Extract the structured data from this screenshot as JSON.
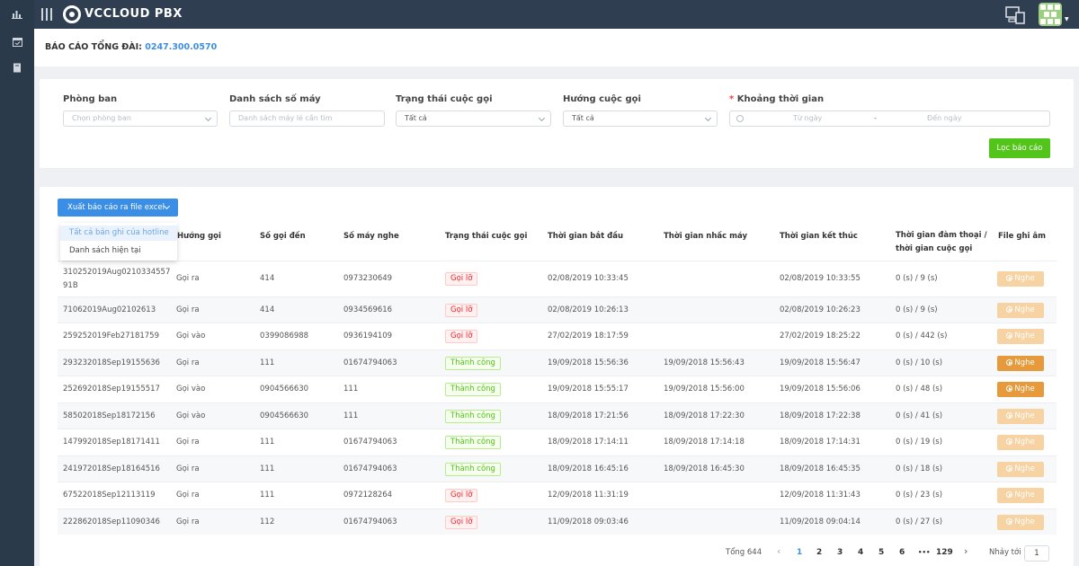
{
  "app": {
    "brand": "VCCLOUD PBX"
  },
  "report": {
    "title_prefix": "BÁO CÁO TỔNG ĐÀI:",
    "hotline": "0247.300.0570"
  },
  "filters": {
    "department": {
      "label": "Phòng ban",
      "placeholder": "Chọn phòng ban"
    },
    "extensions": {
      "label": "Danh sách số máy",
      "placeholder": "Danh sách máy lẻ cần tìm"
    },
    "call_status": {
      "label": "Trạng thái cuộc gọi",
      "value": "Tất cả"
    },
    "direction": {
      "label": "Hướng cuộc gọi",
      "value": "Tất cả"
    },
    "time_range": {
      "label": "Khoảng thời gian",
      "required_mark": "*",
      "from_placeholder": "Từ ngày",
      "separator": "-",
      "to_placeholder": "Đến ngày"
    },
    "submit_label": "Lọc báo cáo"
  },
  "export": {
    "button_label": "Xuất báo cáo ra file excel",
    "options": [
      "Tất cả bản ghi của hotline",
      "Danh sách hiện tại"
    ]
  },
  "table": {
    "columns": [
      "Hướng gọi",
      "Số gọi đến",
      "Số máy nghe",
      "Trạng thái cuộc gọi",
      "Thời gian bắt đầu",
      "Thời gian nhấc máy",
      "Thời gian kết thúc",
      "Thời gian đàm thoại /",
      "thời gian cuộc gọi",
      "File ghi âm"
    ],
    "play_label": "Nghe",
    "rows": [
      {
        "id1": "310252019Aug0210334557",
        "id2": "91B",
        "direction": "Gọi ra",
        "caller": "414",
        "callee": "0973230649",
        "status": "Gọi lỡ",
        "status_type": "fail",
        "start": "02/08/2019 10:33:45",
        "answer": "",
        "end": "02/08/2019 10:33:55",
        "duration": "0 (s) / 9 (s)",
        "playable": false
      },
      {
        "id1": "71062019Aug02102613",
        "id2": "",
        "direction": "Gọi ra",
        "caller": "414",
        "callee": "0934569616",
        "status": "Gọi lỡ",
        "status_type": "fail",
        "start": "02/08/2019 10:26:13",
        "answer": "",
        "end": "02/08/2019 10:26:23",
        "duration": "0 (s) / 9 (s)",
        "playable": false
      },
      {
        "id1": "259252019Feb27181759",
        "id2": "",
        "direction": "Gọi vào",
        "caller": "0399086988",
        "callee": "0936194109",
        "status": "Gọi lỡ",
        "status_type": "fail",
        "start": "27/02/2019 18:17:59",
        "answer": "",
        "end": "27/02/2019 18:25:22",
        "duration": "0 (s) / 442 (s)",
        "playable": false
      },
      {
        "id1": "293232018Sep19155636",
        "id2": "",
        "direction": "Gọi ra",
        "caller": "111",
        "callee": "01674794063",
        "status": "Thành công",
        "status_type": "ok",
        "start": "19/09/2018 15:56:36",
        "answer": "19/09/2018 15:56:43",
        "end": "19/09/2018 15:56:47",
        "duration": "0 (s) / 10 (s)",
        "playable": true
      },
      {
        "id1": "252692018Sep19155517",
        "id2": "",
        "direction": "Gọi vào",
        "caller": "0904566630",
        "callee": "111",
        "status": "Thành công",
        "status_type": "ok",
        "start": "19/09/2018 15:55:17",
        "answer": "19/09/2018 15:56:00",
        "end": "19/09/2018 15:56:06",
        "duration": "0 (s) / 48 (s)",
        "playable": true
      },
      {
        "id1": "58502018Sep18172156",
        "id2": "",
        "direction": "Gọi vào",
        "caller": "0904566630",
        "callee": "111",
        "status": "Thành công",
        "status_type": "ok",
        "start": "18/09/2018 17:21:56",
        "answer": "18/09/2018 17:22:30",
        "end": "18/09/2018 17:22:38",
        "duration": "0 (s) / 41 (s)",
        "playable": false
      },
      {
        "id1": "147992018Sep18171411",
        "id2": "",
        "direction": "Gọi ra",
        "caller": "111",
        "callee": "01674794063",
        "status": "Thành công",
        "status_type": "ok",
        "start": "18/09/2018 17:14:11",
        "answer": "18/09/2018 17:14:18",
        "end": "18/09/2018 17:14:31",
        "duration": "0 (s) / 19 (s)",
        "playable": false
      },
      {
        "id1": "241972018Sep18164516",
        "id2": "",
        "direction": "Gọi ra",
        "caller": "111",
        "callee": "01674794063",
        "status": "Thành công",
        "status_type": "ok",
        "start": "18/09/2018 16:45:16",
        "answer": "18/09/2018 16:45:30",
        "end": "18/09/2018 16:45:35",
        "duration": "0 (s) / 18 (s)",
        "playable": false
      },
      {
        "id1": "67522018Sep12113119",
        "id2": "",
        "direction": "Gọi ra",
        "caller": "111",
        "callee": "0972128264",
        "status": "Gọi lỡ",
        "status_type": "fail",
        "start": "12/09/2018 11:31:19",
        "answer": "",
        "end": "12/09/2018 11:31:43",
        "duration": "0 (s) / 23 (s)",
        "playable": false
      },
      {
        "id1": "222862018Sep11090346",
        "id2": "",
        "direction": "Gọi ra",
        "caller": "112",
        "callee": "01674794063",
        "status": "Gọi lỡ",
        "status_type": "fail",
        "start": "11/09/2018 09:03:46",
        "answer": "",
        "end": "11/09/2018 09:04:14",
        "duration": "0 (s) / 27 (s)",
        "playable": false
      }
    ]
  },
  "pagination": {
    "total_label": "Tổng 644",
    "prev": "‹",
    "pages": [
      "1",
      "2",
      "3",
      "4",
      "5",
      "6",
      "•••",
      "129"
    ],
    "current": "1",
    "next": "›",
    "jump_label": "Nhảy tới",
    "jump_value": "1"
  },
  "colors": {
    "sidebar": "#2b3a4a",
    "topbar": "#2f3e50",
    "primary": "#3a8ee6",
    "success": "#52c41a",
    "danger": "#f5222d",
    "play": "#e69a3c"
  },
  "icons": [
    "chart-icon",
    "calendar-icon",
    "book-icon",
    "menu-icon",
    "logo-icon",
    "device-icon",
    "avatar",
    "chevron-down-icon",
    "clock-icon",
    "play-circle-icon"
  ]
}
